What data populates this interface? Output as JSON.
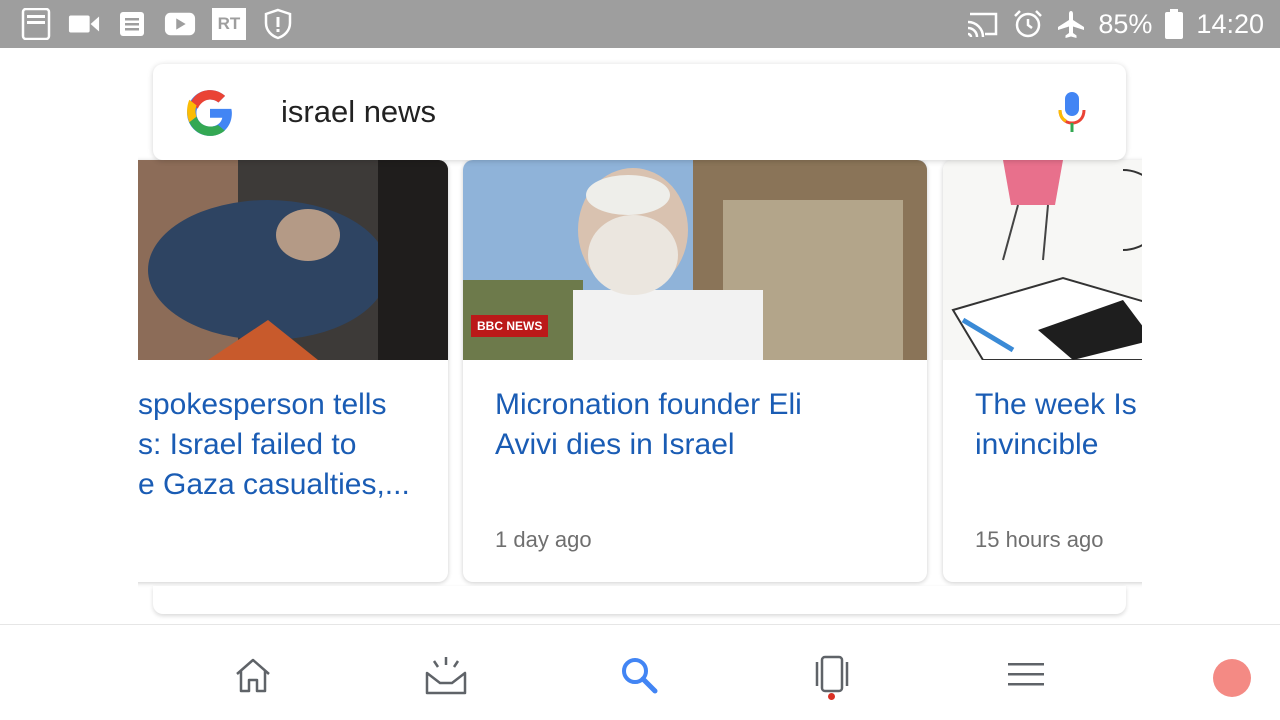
{
  "status_bar": {
    "left_icons": [
      "bible-app-icon",
      "video-camera-icon",
      "notes-icon",
      "youtube-icon",
      "rt-app-icon",
      "shield-alert-icon"
    ],
    "rt_label": "RT",
    "right_icons": [
      "cast-icon",
      "alarm-icon",
      "airplane-mode-icon"
    ],
    "battery": "85%",
    "time": "14:20"
  },
  "search": {
    "query": "israel news",
    "logo": "google-g-icon",
    "mic": "mic-icon"
  },
  "cards": [
    {
      "headline_lines": [
        "spokesperson tells",
        "s: Israel failed to",
        "e Gaza casualties,..."
      ],
      "time": ""
    },
    {
      "headline_lines": [
        "Micronation founder Eli",
        "Avivi dies in Israel"
      ],
      "time": "1 day ago",
      "source_badge": "BBC NEWS"
    },
    {
      "headline_lines": [
        "The week Is",
        "invincible"
      ],
      "time": "15 hours ago"
    }
  ],
  "bottom_nav": {
    "items": [
      "home-icon",
      "updates-inbox-icon",
      "search-icon",
      "recent-tabs-icon",
      "menu-icon"
    ],
    "active": "search-icon"
  },
  "colors": {
    "status_bar": "#9e9e9e",
    "headline": "#1a5cb4",
    "accent_blue": "#4285f4",
    "time_text": "#6f6f6f",
    "avatar": "#f48a84"
  }
}
